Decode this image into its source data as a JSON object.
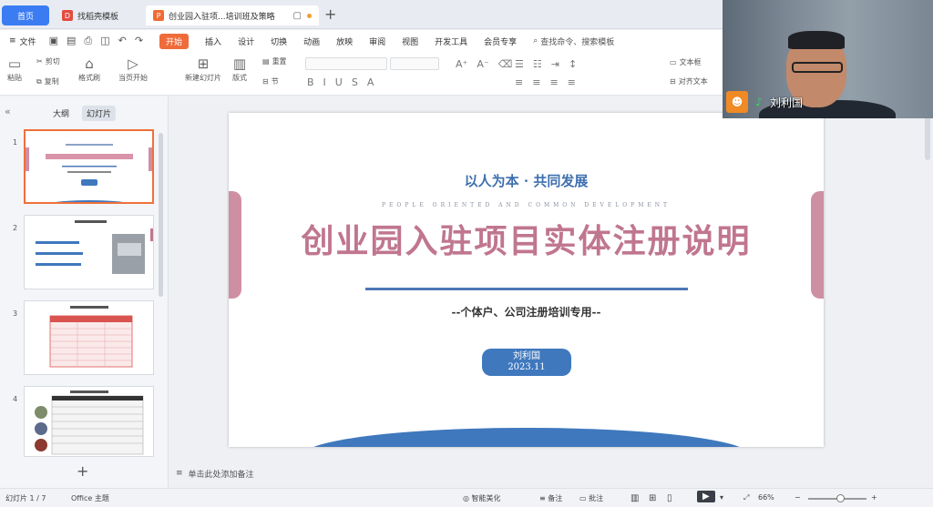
{
  "tabs": [
    {
      "label": "首页"
    },
    {
      "label": "找稻壳模板"
    },
    {
      "label": "创业园入驻项...培训班及策略"
    }
  ],
  "menu": {
    "file": "文件",
    "items": [
      "开始",
      "插入",
      "设计",
      "切换",
      "动画",
      "放映",
      "审阅",
      "视图",
      "开发工具",
      "会员专享"
    ],
    "active": "开始",
    "search": "查找命令、搜索模板"
  },
  "ribbon": {
    "paste": "粘贴",
    "cut": "剪切",
    "copy": "复制",
    "format_painter": "格式刷",
    "start_from_current": "当页开始",
    "new_slide": "新建幻灯片",
    "layout": "版式",
    "section": "节",
    "reset": "重置",
    "text_box": "文本框",
    "align": "对齐文本"
  },
  "left_panel": {
    "outline_tab": "大纲",
    "slides_tab": "幻灯片",
    "slide_numbers": [
      "1",
      "2",
      "3",
      "4"
    ]
  },
  "slide": {
    "motto": "以人为本 · 共同发展",
    "english": "PEOPLE ORIENTED AND COMMON DEVELOPMENT",
    "title": "创业园入驻项目实体注册说明",
    "subtitle": "--个体户、公司注册培训专用--",
    "author": "刘利国",
    "date": "2023.11"
  },
  "notes": {
    "placeholder": "单击此处添加备注"
  },
  "status": {
    "slide_count": "幻灯片 1 / 7",
    "theme": "Office 主题",
    "smart_beautify": "智能美化",
    "notes_toggle": "备注",
    "comments": "批注",
    "zoom": "66%"
  },
  "video": {
    "name": "刘利国"
  },
  "colors": {
    "accent": "#ef6c3a",
    "title_pink": "#c0768f",
    "blue": "#3f78bd"
  }
}
